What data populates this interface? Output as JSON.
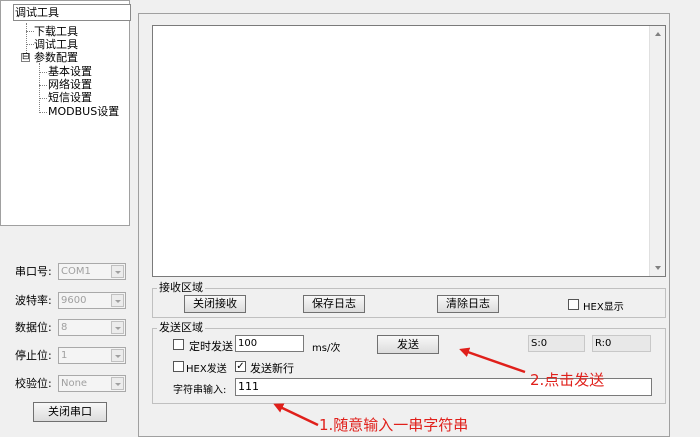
{
  "tree": {
    "title": "调试工具",
    "items": [
      {
        "label": "下载工具"
      },
      {
        "label": "调试工具"
      },
      {
        "label": "参数配置",
        "expander": "⊟"
      },
      {
        "label": "基本设置"
      },
      {
        "label": "网络设置"
      },
      {
        "label": "短信设置"
      },
      {
        "label": "MODBUS设置"
      }
    ]
  },
  "serial": {
    "port_label": "串口号:",
    "port_value": "COM1",
    "baud_label": "波特率:",
    "baud_value": "9600",
    "databits_label": "数据位:",
    "databits_value": "8",
    "stopbits_label": "停止位:",
    "stopbits_value": "1",
    "parity_label": "校验位:",
    "parity_value": "None",
    "close_button": "关闭串口"
  },
  "receive": {
    "group_label": "接收区域",
    "close_recv_button": "关闭接收",
    "save_log_button": "保存日志",
    "clear_log_button": "清除日志",
    "hex_display_label": "HEX显示",
    "hex_display_checked": false
  },
  "send": {
    "group_label": "发送区域",
    "timed_send_label": "定时发送",
    "timed_send_checked": false,
    "interval_value": "100",
    "interval_unit": "ms/次",
    "send_button": "发送",
    "sent_count": "S:0",
    "recv_count": "R:0",
    "hex_send_label": "HEX发送",
    "hex_send_checked": false,
    "newline_label": "发送新行",
    "newline_checked": true,
    "newline_mark": "✓",
    "string_input_label": "字符串输入:",
    "string_input_value": "111"
  },
  "annotations": {
    "step1": "1.随意输入一串字符串",
    "step2": "2.点击发送",
    "color": "#e0201b"
  }
}
